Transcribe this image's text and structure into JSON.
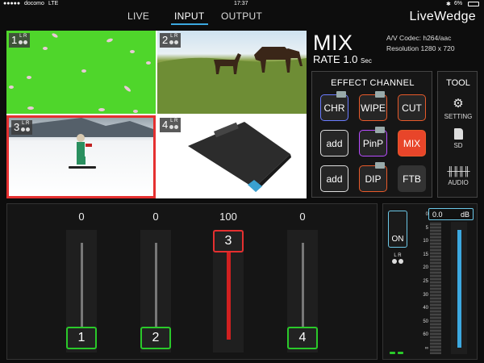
{
  "status": {
    "carrier": "docomo",
    "network": "LTE",
    "time": "17:37",
    "battery": "6%"
  },
  "nav": {
    "tabs": [
      {
        "label": "LIVE"
      },
      {
        "label": "INPUT"
      },
      {
        "label": "OUTPUT"
      }
    ],
    "active": "INPUT"
  },
  "brand": "LiveWedge",
  "preview": [
    {
      "num": "1",
      "l": "L",
      "r": "R"
    },
    {
      "num": "2",
      "l": "L",
      "r": "R"
    },
    {
      "num": "3",
      "l": "L",
      "r": "R"
    },
    {
      "num": "4",
      "l": "L",
      "r": "R"
    }
  ],
  "info": {
    "mode": "MIX",
    "rate_label": "RATE",
    "rate_value": "1.0",
    "rate_unit": "Sec",
    "codec": "A/V Codec:  h264/aac",
    "resolution": "Resolution  1280 x 720"
  },
  "effect": {
    "title": "EFFECT CHANNEL",
    "buttons": [
      {
        "label": "CHR",
        "color": "#6b7cff"
      },
      {
        "label": "WIPE",
        "color": "#e85a2a"
      },
      {
        "label": "CUT",
        "color": "#e85a2a"
      },
      {
        "label": "add",
        "color": "#dddddd"
      },
      {
        "label": "PinP",
        "color": "#b84cff"
      },
      {
        "label": "MIX",
        "color": "#e85a2a"
      },
      {
        "label": "add",
        "color": "#dddddd"
      },
      {
        "label": "DIP",
        "color": "#e85a2a"
      },
      {
        "label": "FTB",
        "color": "#333333"
      }
    ]
  },
  "tool": {
    "title": "TOOL",
    "items": [
      {
        "label": "SETTING",
        "icon": "gear-icon"
      },
      {
        "label": "SD",
        "icon": "sd-card-icon"
      },
      {
        "label": "AUDIO",
        "icon": "mixer-sliders-icon"
      }
    ]
  },
  "faders": [
    {
      "value": "0",
      "label": "1",
      "level": 0
    },
    {
      "value": "0",
      "label": "2",
      "level": 0
    },
    {
      "value": "100",
      "label": "3",
      "level": 100,
      "active": true
    },
    {
      "value": "0",
      "label": "4",
      "level": 0
    }
  ],
  "master": {
    "on_label": "ON",
    "l": "L",
    "r": "R",
    "db_value": "0.0",
    "db_unit": "dB",
    "scale": [
      "0",
      "5",
      "10",
      "15",
      "20",
      "25",
      "30",
      "40",
      "50",
      "60",
      "∞"
    ],
    "level_db": 0
  }
}
